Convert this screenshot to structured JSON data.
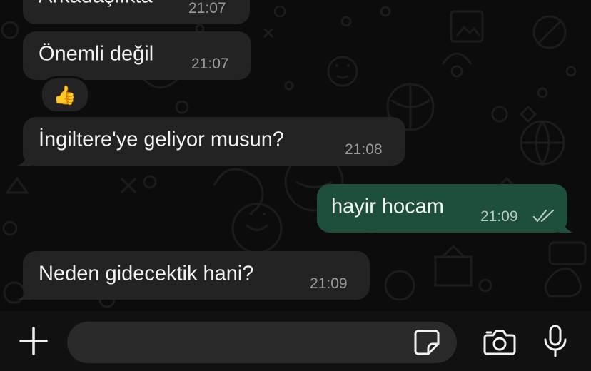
{
  "messages": [
    {
      "direction": "in",
      "text": "Arkadaşlıkta",
      "time": "21:07"
    },
    {
      "direction": "in",
      "text": "Önemli değil",
      "time": "21:07",
      "reaction": "👍"
    },
    {
      "direction": "in",
      "text": "İngiltere'ye geliyor musun?",
      "time": "21:08"
    },
    {
      "direction": "out",
      "text": "hayir hocam",
      "time": "21:09",
      "status": "read-double-check"
    },
    {
      "direction": "in",
      "text": "Neden gidecektik hani?",
      "time": "21:09"
    }
  ],
  "composer": {
    "input_value": "",
    "icons": [
      "plus-icon",
      "sticker-icon",
      "camera-icon",
      "microphone-icon"
    ]
  },
  "colors": {
    "background": "#0c0c0c",
    "incoming_bubble": "#232323",
    "outgoing_bubble": "#1e4f3b",
    "text": "#f2f2f2",
    "timestamp": "#9a9a9a",
    "composer_bar": "#111111",
    "input_field": "#2a2a2a"
  }
}
